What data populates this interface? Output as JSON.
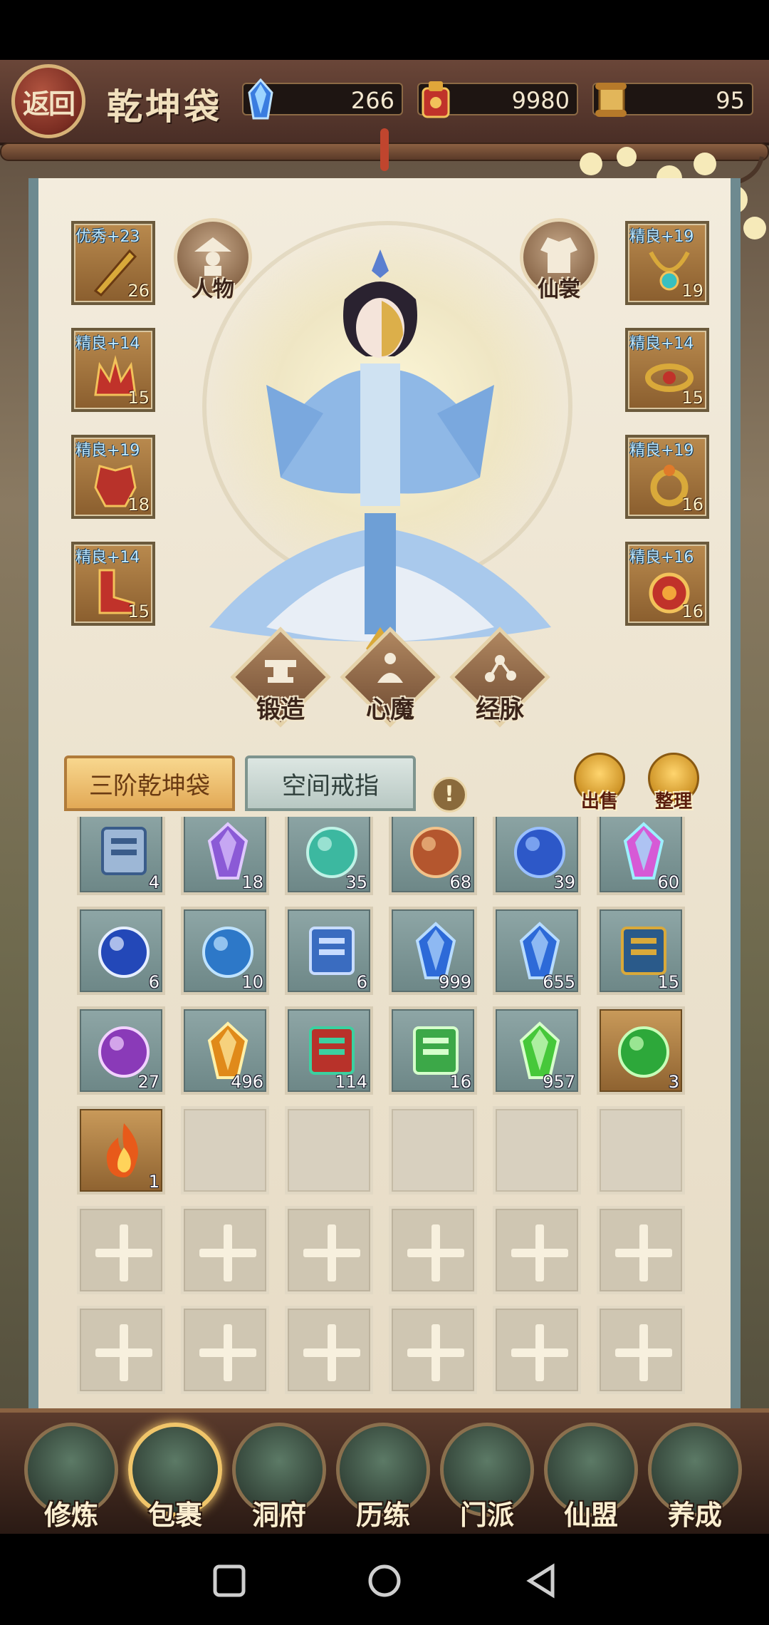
{
  "header": {
    "back_label": "返回",
    "title": "乾坤袋",
    "resources": [
      {
        "icon": "blue-crystal-icon",
        "value": "266"
      },
      {
        "icon": "red-pouch-icon",
        "value": "9980"
      },
      {
        "icon": "scroll-icon",
        "value": "95"
      }
    ]
  },
  "equipment_left": [
    {
      "badge": "优秀+23",
      "count": "26",
      "icon": "sword-icon"
    },
    {
      "badge": "精良+14",
      "count": "15",
      "icon": "crown-icon"
    },
    {
      "badge": "精良+19",
      "count": "18",
      "icon": "armor-icon"
    },
    {
      "badge": "精良+14",
      "count": "15",
      "icon": "boots-icon"
    }
  ],
  "equipment_right": [
    {
      "badge": "精良+19",
      "count": "19",
      "icon": "necklace-icon"
    },
    {
      "badge": "精良+14",
      "count": "15",
      "icon": "belt-icon"
    },
    {
      "badge": "精良+19",
      "count": "16",
      "icon": "ring-icon"
    },
    {
      "badge": "精良+16",
      "count": "16",
      "icon": "amulet-icon"
    }
  ],
  "character_buttons": {
    "left": "人物",
    "right": "仙裳"
  },
  "actions": [
    "锻造",
    "心魔",
    "经脉"
  ],
  "tabs": {
    "active": "三阶乾坤袋",
    "inactive": "空间戒指"
  },
  "bag_actions": {
    "sell": "出售",
    "sort": "整理"
  },
  "bag_items": [
    {
      "icon": "scroll-item-icon",
      "qty": "4",
      "gold": false
    },
    {
      "icon": "purple-crystal-icon",
      "qty": "18",
      "gold": false
    },
    {
      "icon": "jade-stone-icon",
      "qty": "35",
      "gold": false
    },
    {
      "icon": "seed-bag-icon",
      "qty": "68",
      "gold": false
    },
    {
      "icon": "berries-icon",
      "qty": "39",
      "gold": false
    },
    {
      "icon": "rainbow-crystal-icon",
      "qty": "60",
      "gold": false
    },
    {
      "icon": "yin-yang-orb-icon",
      "qty": "6",
      "gold": false
    },
    {
      "icon": "blue-pouch-icon",
      "qty": "10",
      "gold": false
    },
    {
      "icon": "blue-scroll-icon",
      "qty": "6",
      "gold": false
    },
    {
      "icon": "blue-crystal-item-icon",
      "qty": "999",
      "gold": false
    },
    {
      "icon": "blue-crystal-item-icon",
      "qty": "655",
      "gold": false
    },
    {
      "icon": "book-icon",
      "qty": "15",
      "gold": false
    },
    {
      "icon": "purple-pouch-icon",
      "qty": "27",
      "gold": false
    },
    {
      "icon": "orange-token-icon",
      "qty": "496",
      "gold": false
    },
    {
      "icon": "treasure-box-icon",
      "qty": "114",
      "gold": false
    },
    {
      "icon": "green-scroll-icon",
      "qty": "16",
      "gold": false
    },
    {
      "icon": "green-crystal-icon",
      "qty": "957",
      "gold": false
    },
    {
      "icon": "green-orb-icon",
      "qty": "3",
      "gold": true
    },
    {
      "icon": "flame-icon",
      "qty": "1",
      "gold": true
    }
  ],
  "bottom_nav": [
    {
      "label": "修炼",
      "active": false
    },
    {
      "label": "包裹",
      "active": true
    },
    {
      "label": "洞府",
      "active": false
    },
    {
      "label": "历练",
      "active": false
    },
    {
      "label": "门派",
      "active": false
    },
    {
      "label": "仙盟",
      "active": false
    },
    {
      "label": "养成",
      "active": false
    }
  ],
  "colors": {
    "accent_gold": "#f0c56a",
    "panel": "#f3ecdd",
    "frame": "#4a2e26"
  }
}
